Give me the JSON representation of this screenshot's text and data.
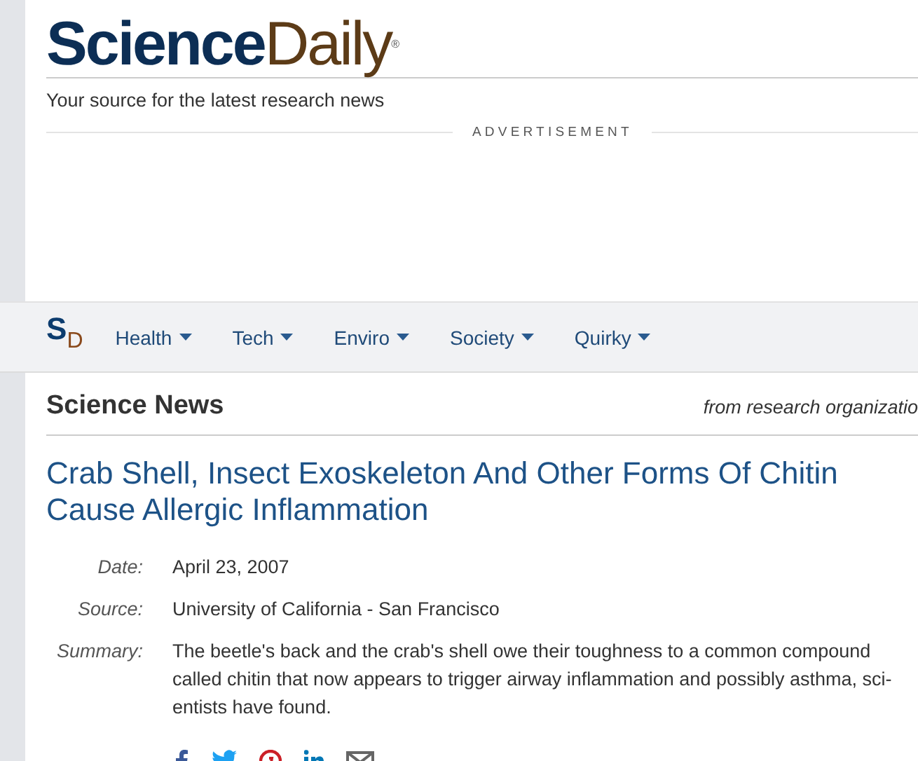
{
  "logo": {
    "primary": "Science",
    "secondary": "Daily",
    "mark": "®"
  },
  "tagline": "Your source for the latest research news",
  "ad_label": "ADVERTISEMENT",
  "nav": {
    "logo_s": "S",
    "logo_d": "D",
    "items": [
      {
        "label": "Health"
      },
      {
        "label": "Tech"
      },
      {
        "label": "Enviro"
      },
      {
        "label": "Society"
      },
      {
        "label": "Quirky"
      }
    ]
  },
  "section": {
    "title": "Science News",
    "subtitle": "from research organizatio"
  },
  "article": {
    "title_lines": [
      "Crab Shell, Insect Exoskeleton And Other Forms Of Chitin",
      "Cause Allergic Inflammation"
    ],
    "meta": [
      {
        "label": "Date:",
        "value_lines": [
          "April 23, 2007"
        ]
      },
      {
        "label": "Source:",
        "value_lines": [
          "University of California - San Francisco"
        ]
      },
      {
        "label": "Summary:",
        "value_lines": [
          "The beetle's back and the crab's shell owe their toughness to a common compound",
          "called chitin that now appears to trigger airway inflammation and possibly asthma, sci-",
          "entists have found."
        ]
      }
    ]
  }
}
